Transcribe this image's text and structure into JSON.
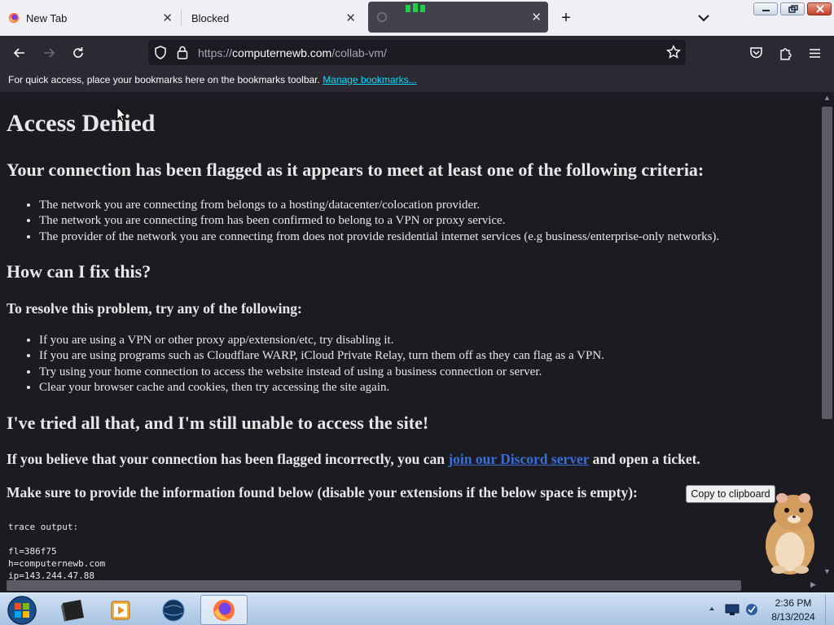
{
  "browser": {
    "tabs": [
      {
        "title": "New Tab",
        "active": false
      },
      {
        "title": "Blocked",
        "active": false
      },
      {
        "title": "",
        "active": true
      }
    ],
    "url": {
      "scheme": "https://",
      "host": "computernewb.com",
      "path": "/collab-vm/"
    },
    "bookmarks_bar": {
      "text": "For quick access, place your bookmarks here on the bookmarks toolbar.",
      "link": "Manage bookmarks..."
    }
  },
  "page": {
    "title": "Access Denied",
    "flagged_heading": "Your connection has been flagged as it appears to meet at least one of the following criteria:",
    "criteria": [
      "The network you are connecting from belongs to a hosting/datacenter/colocation provider.",
      "The network you are connecting from has been confirmed to belong to a VPN or proxy service.",
      "The provider of the network you are connecting from does not provide residential internet services (e.g business/enterprise-only networks)."
    ],
    "fix_heading": "How can I fix this?",
    "resolve_heading": "To resolve this problem, try any of the following:",
    "fixes": [
      "If you are using a VPN or other proxy app/extension/etc, try disabling it.",
      "If you are using programs such as Cloudflare WARP, iCloud Private Relay, turn them off as they can flag as a VPN.",
      "Try using your home connection to access the website instead of using a business connection or server.",
      "Clear your browser cache and cookies, then try accessing the site again."
    ],
    "still_heading": "I've tried all that, and I'm still unable to access the site!",
    "incorrect": {
      "before": "If you believe that your connection has been flagged incorrectly, you can ",
      "link": "join our Discord server",
      "after": " and open a ticket."
    },
    "info_text": "Make sure to provide the information found below (disable your extensions if the below space is empty):",
    "copy_button": "Copy to clipboard",
    "trace_label": "trace output:",
    "trace_lines": [
      "fl=386f75",
      "h=computernewb.com",
      "ip=143.244.47.88"
    ]
  },
  "taskbar": {
    "apps": [
      "start-orb",
      "terminal",
      "media-player",
      "network-globe",
      "firefox"
    ],
    "time": "2:36 PM",
    "date": "8/13/2024"
  },
  "colors": {
    "page_bg": "#1c1b22",
    "toolbar_bg": "#2b2a33",
    "link": "#3a6fd8",
    "bookmark_link": "#00ddff"
  }
}
